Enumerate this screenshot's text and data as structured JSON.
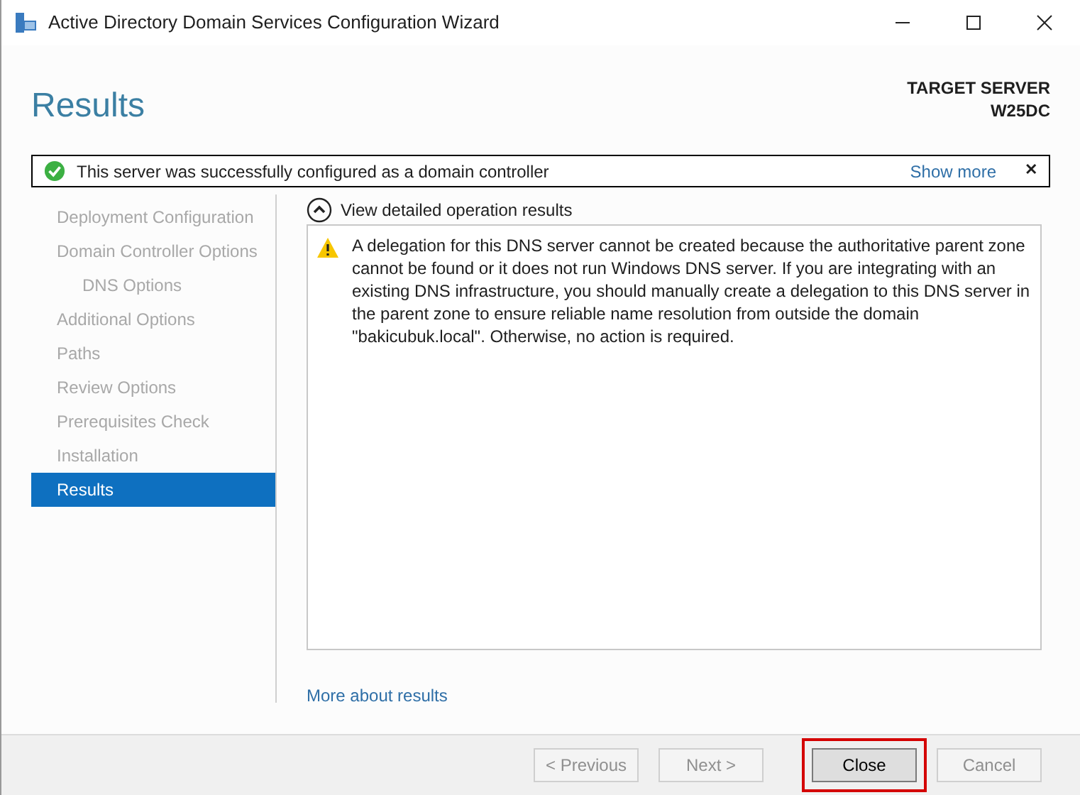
{
  "window": {
    "title": "Active Directory Domain Services Configuration Wizard"
  },
  "page_title": "Results",
  "target_server": {
    "label": "TARGET SERVER",
    "name": "W25DC"
  },
  "banner": {
    "message": "This server was successfully configured as a domain controller",
    "link": "Show more",
    "close": "✕"
  },
  "steps": [
    {
      "label": "Deployment Configuration",
      "selected": false
    },
    {
      "label": "Domain Controller Options",
      "selected": false,
      "children": [
        {
          "label": "DNS Options",
          "selected": false
        }
      ]
    },
    {
      "label": "Additional Options",
      "selected": false
    },
    {
      "label": "Paths",
      "selected": false
    },
    {
      "label": "Review Options",
      "selected": false
    },
    {
      "label": "Prerequisites Check",
      "selected": false
    },
    {
      "label": "Installation",
      "selected": false
    },
    {
      "label": "Results",
      "selected": true
    }
  ],
  "details": {
    "heading": "View detailed operation results",
    "expanded": true,
    "messages": [
      {
        "kind": "warning",
        "text": "A delegation for this DNS server cannot be created because the authoritative parent zone cannot be found or it does not run Windows DNS server. If you are integrating with an existing DNS infrastructure, you should manually create a delegation to this DNS server in the parent zone to ensure reliable name resolution from outside the domain \"bakicubuk.local\". Otherwise, no action is required."
      }
    ]
  },
  "more_link": "More about results",
  "buttons": [
    {
      "label": "< Previous",
      "disabled": true,
      "highlighted": false
    },
    {
      "label": "Next >",
      "disabled": true,
      "highlighted": false
    },
    {
      "label": "Close",
      "disabled": false,
      "highlighted": true
    },
    {
      "label": "Cancel",
      "disabled": true,
      "highlighted": false
    }
  ]
}
